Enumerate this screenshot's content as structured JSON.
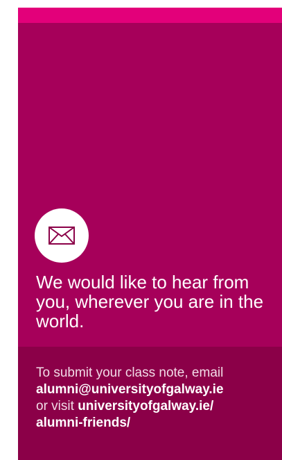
{
  "card": {
    "icon": "envelope-icon",
    "headline": "We would like to hear from you, wherever you are in the world.",
    "footer": {
      "intro": "To submit your class note, email",
      "email": "alumni@universityofgalway.ie",
      "connector": "or visit",
      "url_line1": "universityofgalway.ie/",
      "url_line2": "alumni-friends/"
    }
  },
  "colors": {
    "card_background": "#a6005a",
    "top_accent": "#e3007a",
    "footer_background": "#8b0048",
    "headline_text": "#ffffff",
    "footer_text": "#f2dbe7"
  }
}
